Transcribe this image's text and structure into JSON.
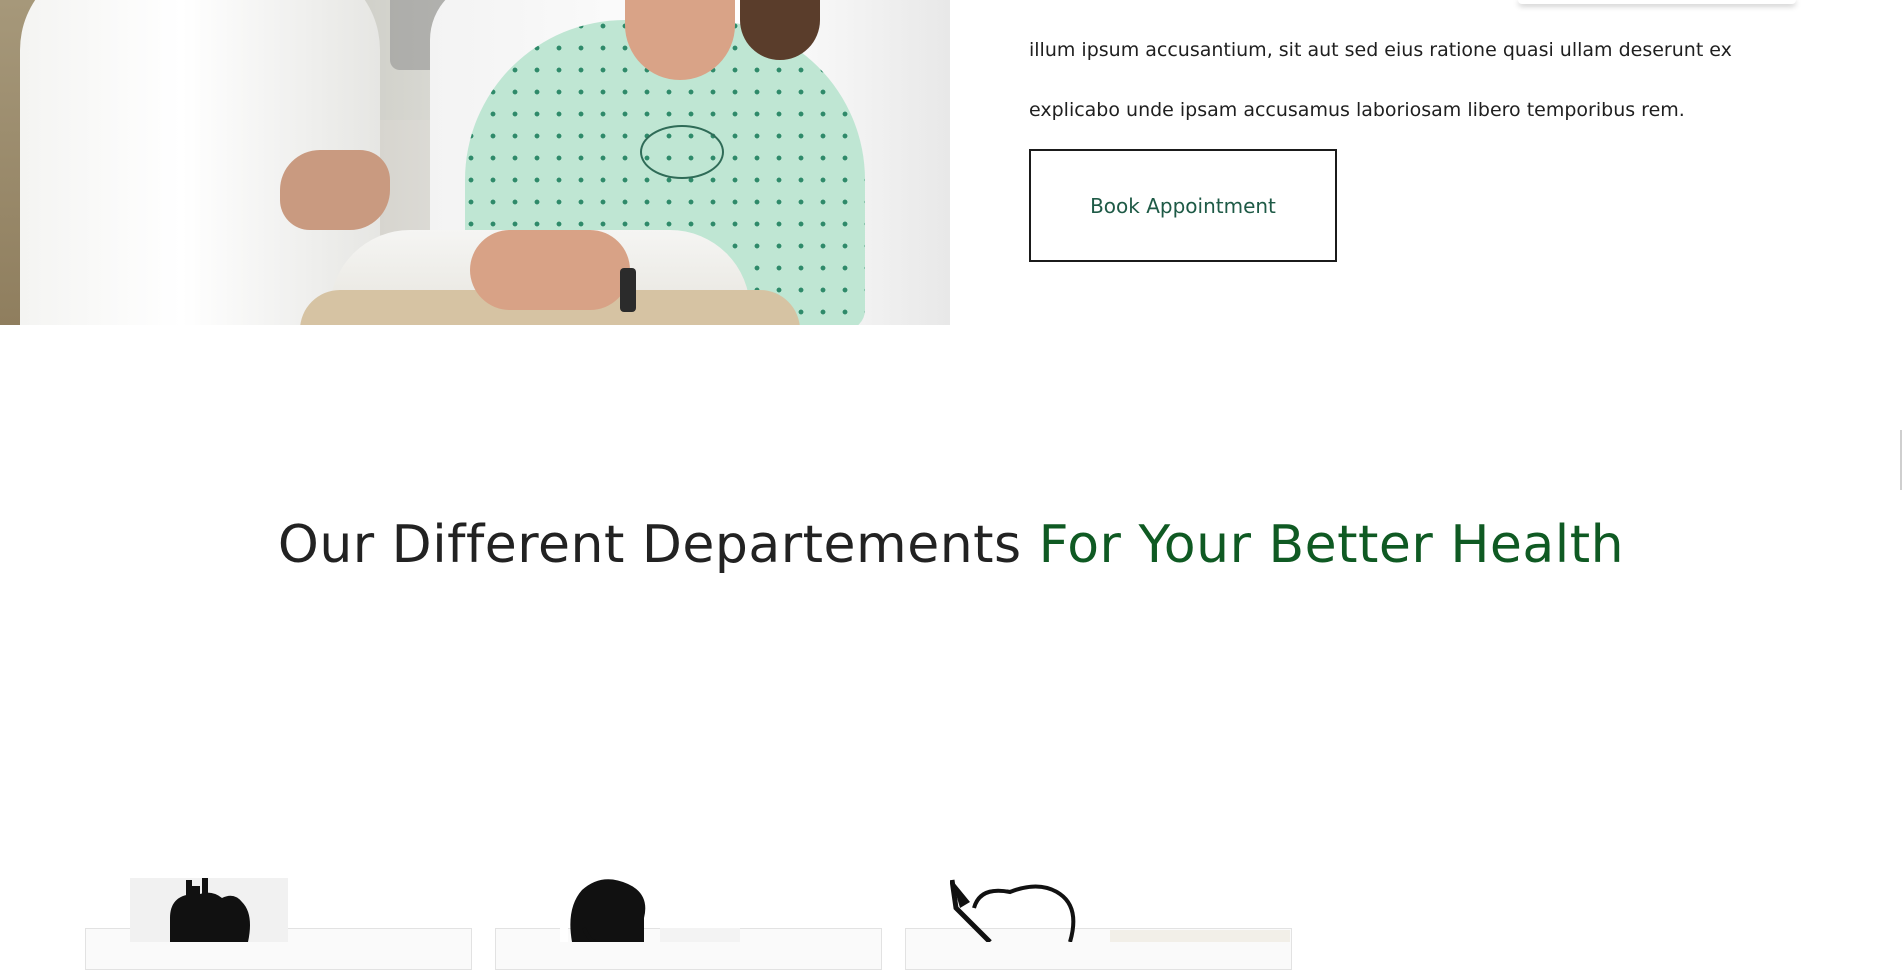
{
  "intro": {
    "text": "illum ipsum accusantium, sit aut sed eius ratione quasi ullam deserunt ex explicabo unde ipsam accusamus laboriosam libero temporibus rem.",
    "cta_label": "Book Appointment"
  },
  "departments_section": {
    "heading_main": "Our Different Departements",
    "heading_accent": "For Your Better Health",
    "accent_color": "#0f5a23",
    "cards": [
      {
        "icon": "heart-icon"
      },
      {
        "icon": "doctor-head-icon"
      },
      {
        "icon": "scalpel-stomach-icon"
      }
    ]
  },
  "hero": {
    "image": "doctor-and-patient-photo"
  }
}
